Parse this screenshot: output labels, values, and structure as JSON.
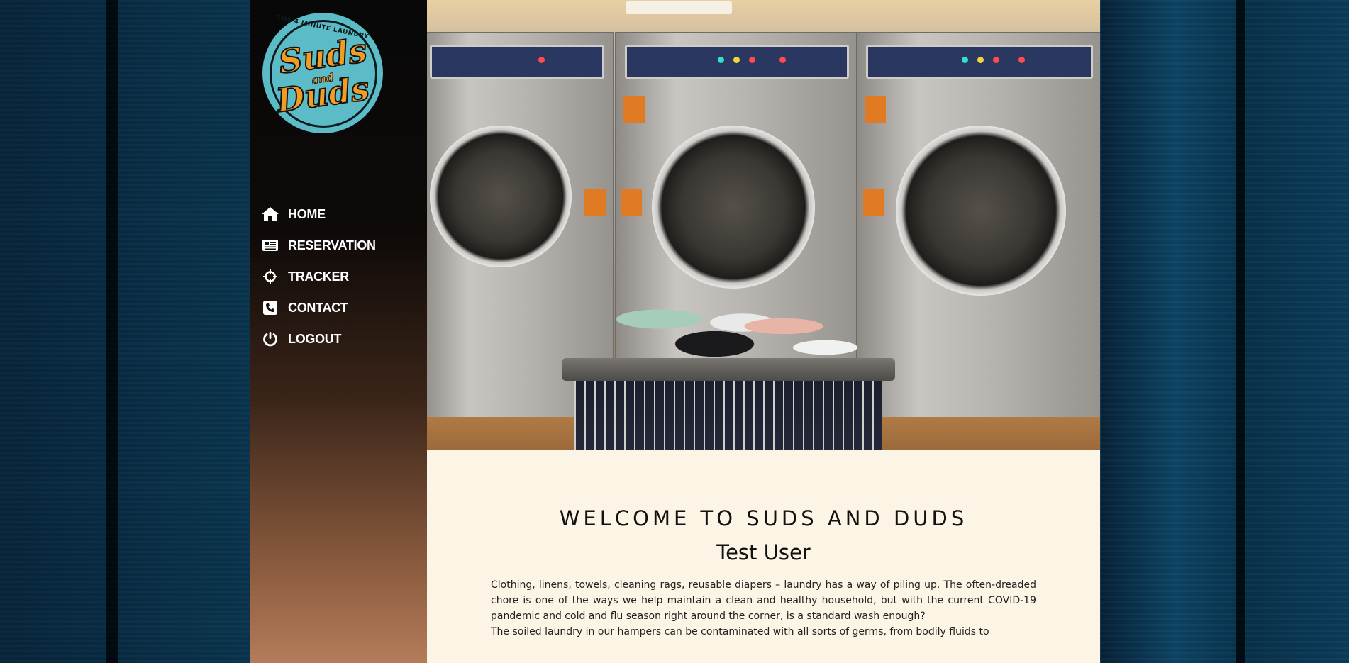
{
  "logo": {
    "tagline": "THE 4 MINUTE LAUNDRY",
    "word_1": "Suds",
    "word_2": "and",
    "word_3": "Duds",
    "colors": {
      "badge": "#5bbcc8",
      "lettering": "#f39c24"
    }
  },
  "nav": {
    "items": [
      {
        "label": "HOME",
        "icon": "home-icon"
      },
      {
        "label": "RESERVATION",
        "icon": "newspaper-icon"
      },
      {
        "label": "TRACKER",
        "icon": "crosshair-icon"
      },
      {
        "label": "CONTACT",
        "icon": "phone-icon"
      },
      {
        "label": "LOGOUT",
        "icon": "power-icon"
      }
    ]
  },
  "hero": {
    "image": "laundromat-washers-photo"
  },
  "main": {
    "heading": "WELCOME TO SUDS AND DUDS",
    "user_name": "Test User",
    "paragraph_1": "Clothing, linens, towels, cleaning rags, reusable diapers – laundry has a way of piling up. The often-dreaded chore is one of the ways we help maintain a clean and healthy household, but with the current COVID-19 pandemic and cold and flu season right around the corner, is a standard wash enough?",
    "paragraph_2": "The soiled laundry in our hampers can be contaminated with all sorts of germs, from bodily fluids to"
  }
}
